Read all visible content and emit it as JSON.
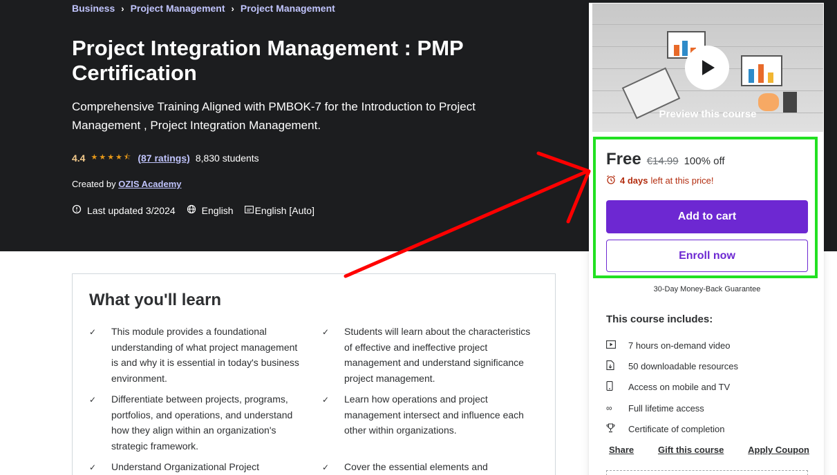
{
  "breadcrumb": {
    "items": [
      "Business",
      "Project Management",
      "Project Management"
    ],
    "separator": "›"
  },
  "course": {
    "title": "Project Integration Management : PMP Certification",
    "subtitle": "Comprehensive Training Aligned with PMBOK-7 for the Introduction to Project Management , Project Integration Management.",
    "rating": "4.4",
    "stars": "★★★★⯪",
    "rating_count": "(87 ratings)",
    "students": "8,830 students",
    "created_by_label": "Created by",
    "author": "OZIS Academy",
    "last_updated": "Last updated 3/2024",
    "language": "English",
    "captions": "English [Auto]"
  },
  "learn": {
    "title": "What you'll learn",
    "items": [
      "This module provides a foundational understanding of what project management is and why it is essential in today's business environment.",
      "Students will learn about the characteristics of effective and ineffective project management and understand significance project management.",
      "Differentiate between projects, programs, portfolios, and operations, and understand how they align within an organization's strategic framework.",
      "Learn how operations and project management intersect and influence each other within organizations.",
      "Understand Organizational Project",
      "Cover the essential elements and components"
    ]
  },
  "sidebar": {
    "preview_label": "Preview this course",
    "price_free": "Free",
    "price_old": "€14.99",
    "price_off": "100% off",
    "timer_bold": "4 days",
    "timer_rest": "left at this price!",
    "add_to_cart": "Add to cart",
    "enroll_now": "Enroll now",
    "guarantee": "30-Day Money-Back Guarantee",
    "includes_title": "This course includes:",
    "includes": [
      {
        "icon": "video-icon",
        "text": "7 hours on-demand video"
      },
      {
        "icon": "file-download-icon",
        "text": "50 downloadable resources"
      },
      {
        "icon": "mobile-icon",
        "text": "Access on mobile and TV"
      },
      {
        "icon": "infinity-icon",
        "text": "Full lifetime access"
      },
      {
        "icon": "trophy-icon",
        "text": "Certificate of completion"
      }
    ],
    "links": {
      "share": "Share",
      "gift": "Gift this course",
      "coupon": "Apply Coupon"
    }
  },
  "colors": {
    "hero_bg": "#1c1d1f",
    "accent_purple": "#6d28d2",
    "link_purple": "#c0c4fc",
    "star_gold": "#e59819",
    "timer_red": "#b32d0f",
    "highlight_green": "#22e022",
    "arrow_red": "#ff0000"
  }
}
